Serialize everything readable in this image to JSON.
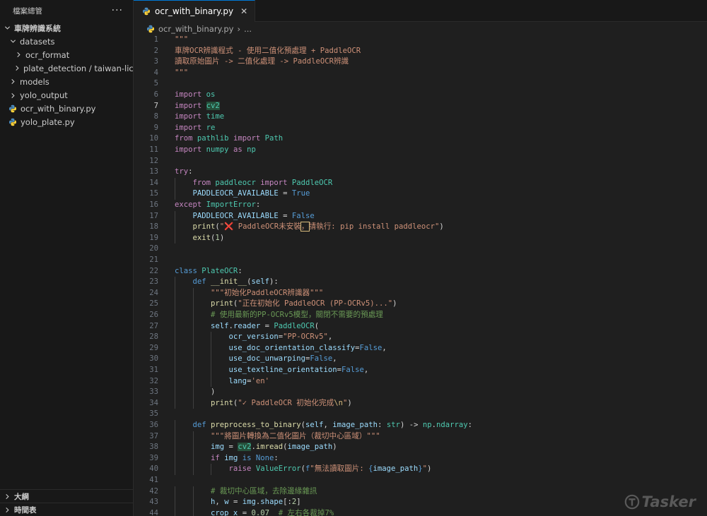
{
  "sidebar": {
    "title": "檔案總管",
    "more": "···",
    "tree": [
      {
        "label": "車牌辨識系統",
        "kind": "folder-root",
        "chevron": "down",
        "indent": 0
      },
      {
        "label": "datasets",
        "kind": "folder",
        "chevron": "down",
        "indent": 1
      },
      {
        "label": "ocr_format",
        "kind": "folder",
        "chevron": "right",
        "indent": 2
      },
      {
        "label": "plate_detection / taiwan-lice...",
        "kind": "folder",
        "chevron": "right",
        "indent": 2
      },
      {
        "label": "models",
        "kind": "folder",
        "chevron": "right",
        "indent": 1
      },
      {
        "label": "yolo_output",
        "kind": "folder",
        "chevron": "right",
        "indent": 1
      },
      {
        "label": "ocr_with_binary.py",
        "kind": "python-file",
        "chevron": "",
        "indent": 1
      },
      {
        "label": "yolo_plate.py",
        "kind": "python-file",
        "chevron": "",
        "indent": 1
      }
    ],
    "footer": [
      {
        "label": "大綱"
      },
      {
        "label": "時間表"
      }
    ]
  },
  "editor": {
    "tab": {
      "label": "ocr_with_binary.py",
      "close": "✕"
    },
    "breadcrumb": {
      "file": "ocr_with_binary.py",
      "rest": "..."
    },
    "current_line": 7,
    "lines": [
      [
        [
          "s",
          "\"\"\""
        ]
      ],
      [
        [
          "s",
          "車牌OCR辨識程式 - 使用二值化預處理 + PaddleOCR"
        ]
      ],
      [
        [
          "s",
          "讀取原始圖片 -> 二值化處理 -> PaddleOCR辨識"
        ]
      ],
      [
        [
          "s",
          "\"\"\""
        ]
      ],
      [],
      [
        [
          "k",
          "import"
        ],
        [
          "p",
          " "
        ],
        [
          "cl",
          "os"
        ]
      ],
      [
        [
          "k",
          "import"
        ],
        [
          "p",
          " "
        ],
        [
          "cl hl",
          "cv2"
        ]
      ],
      [
        [
          "k",
          "import"
        ],
        [
          "p",
          " "
        ],
        [
          "cl",
          "time"
        ]
      ],
      [
        [
          "k",
          "import"
        ],
        [
          "p",
          " "
        ],
        [
          "cl",
          "re"
        ]
      ],
      [
        [
          "k",
          "from"
        ],
        [
          "p",
          " "
        ],
        [
          "cl",
          "pathlib"
        ],
        [
          "p",
          " "
        ],
        [
          "k",
          "import"
        ],
        [
          "p",
          " "
        ],
        [
          "cl",
          "Path"
        ]
      ],
      [
        [
          "k",
          "import"
        ],
        [
          "p",
          " "
        ],
        [
          "cl",
          "numpy"
        ],
        [
          "p",
          " "
        ],
        [
          "k",
          "as"
        ],
        [
          "p",
          " "
        ],
        [
          "cl",
          "np"
        ]
      ],
      [],
      [
        [
          "k",
          "try"
        ],
        [
          "p",
          ":"
        ]
      ],
      [
        [
          "p",
          "    "
        ],
        [
          "k",
          "from"
        ],
        [
          "p",
          " "
        ],
        [
          "cl",
          "paddleocr"
        ],
        [
          "p",
          " "
        ],
        [
          "k",
          "import"
        ],
        [
          "p",
          " "
        ],
        [
          "cl",
          "PaddleOCR"
        ]
      ],
      [
        [
          "p",
          "    "
        ],
        [
          "v",
          "PADDLEOCR_AVAILABLE"
        ],
        [
          "p",
          " = "
        ],
        [
          "kb",
          "True"
        ]
      ],
      [
        [
          "k",
          "except"
        ],
        [
          "p",
          " "
        ],
        [
          "cl",
          "ImportError"
        ],
        [
          "p",
          ":"
        ]
      ],
      [
        [
          "p",
          "    "
        ],
        [
          "v",
          "PADDLEOCR_AVAILABLE"
        ],
        [
          "p",
          " = "
        ],
        [
          "kb",
          "False"
        ]
      ],
      [
        [
          "p",
          "    "
        ],
        [
          "f",
          "print"
        ],
        [
          "p",
          "("
        ],
        [
          "s",
          "\"❌ PaddleOCR未安裝"
        ],
        [
          "s box",
          "，"
        ],
        [
          "s",
          "請執行: pip install paddleocr\""
        ],
        [
          "p",
          ")"
        ]
      ],
      [
        [
          "p",
          "    "
        ],
        [
          "f",
          "exit"
        ],
        [
          "p",
          "("
        ],
        [
          "n",
          "1"
        ],
        [
          "p",
          ")"
        ]
      ],
      [],
      [],
      [
        [
          "kb",
          "class"
        ],
        [
          "p",
          " "
        ],
        [
          "cl",
          "PlateOCR"
        ],
        [
          "p",
          ":"
        ]
      ],
      [
        [
          "p",
          "    "
        ],
        [
          "kb",
          "def"
        ],
        [
          "p",
          " "
        ],
        [
          "f",
          "__init__"
        ],
        [
          "p",
          "("
        ],
        [
          "v",
          "self"
        ],
        [
          "p",
          "):"
        ]
      ],
      [
        [
          "p",
          "        "
        ],
        [
          "s",
          "\"\"\"初始化PaddleOCR辨識器\"\"\""
        ]
      ],
      [
        [
          "p",
          "        "
        ],
        [
          "f",
          "print"
        ],
        [
          "p",
          "("
        ],
        [
          "s",
          "\"正在初始化 PaddleOCR (PP-OCRv5)...\""
        ],
        [
          "p",
          ")"
        ]
      ],
      [
        [
          "p",
          "        "
        ],
        [
          "c",
          "# 使用最新的PP-OCRv5模型，關閉不需要的預處理"
        ]
      ],
      [
        [
          "p",
          "        "
        ],
        [
          "v",
          "self"
        ],
        [
          "p",
          "."
        ],
        [
          "v",
          "reader"
        ],
        [
          "p",
          " = "
        ],
        [
          "cl",
          "PaddleOCR"
        ],
        [
          "p",
          "("
        ]
      ],
      [
        [
          "p",
          "            "
        ],
        [
          "v",
          "ocr_version"
        ],
        [
          "p",
          "="
        ],
        [
          "s",
          "\"PP-OCRv5\""
        ],
        [
          "p",
          ","
        ]
      ],
      [
        [
          "p",
          "            "
        ],
        [
          "v",
          "use_doc_orientation_classify"
        ],
        [
          "p",
          "="
        ],
        [
          "kb",
          "False"
        ],
        [
          "p",
          ","
        ]
      ],
      [
        [
          "p",
          "            "
        ],
        [
          "v",
          "use_doc_unwarping"
        ],
        [
          "p",
          "="
        ],
        [
          "kb",
          "False"
        ],
        [
          "p",
          ","
        ]
      ],
      [
        [
          "p",
          "            "
        ],
        [
          "v",
          "use_textline_orientation"
        ],
        [
          "p",
          "="
        ],
        [
          "kb",
          "False"
        ],
        [
          "p",
          ","
        ]
      ],
      [
        [
          "p",
          "            "
        ],
        [
          "v",
          "lang"
        ],
        [
          "p",
          "="
        ],
        [
          "s",
          "'en'"
        ]
      ],
      [
        [
          "p",
          "        )"
        ]
      ],
      [
        [
          "p",
          "        "
        ],
        [
          "f",
          "print"
        ],
        [
          "p",
          "("
        ],
        [
          "s",
          "\"✓ PaddleOCR 初始化完成"
        ],
        [
          "esc",
          "\\n"
        ],
        [
          "s",
          "\""
        ],
        [
          "p",
          ")"
        ]
      ],
      [],
      [
        [
          "p",
          "    "
        ],
        [
          "kb",
          "def"
        ],
        [
          "p",
          " "
        ],
        [
          "f",
          "preprocess_to_binary"
        ],
        [
          "p",
          "("
        ],
        [
          "v",
          "self"
        ],
        [
          "p",
          ", "
        ],
        [
          "v",
          "image_path"
        ],
        [
          "p",
          ": "
        ],
        [
          "cl",
          "str"
        ],
        [
          "p",
          ") -> "
        ],
        [
          "cl",
          "np"
        ],
        [
          "p",
          "."
        ],
        [
          "cl",
          "ndarray"
        ],
        [
          "p",
          ":"
        ]
      ],
      [
        [
          "p",
          "        "
        ],
        [
          "s",
          "\"\"\"將圖片轉換為二值化圖片（裁切中心區域）\"\"\""
        ]
      ],
      [
        [
          "p",
          "        "
        ],
        [
          "v",
          "img"
        ],
        [
          "p",
          " = "
        ],
        [
          "cl hl",
          "cv2"
        ],
        [
          "p",
          "."
        ],
        [
          "f",
          "imread"
        ],
        [
          "p",
          "("
        ],
        [
          "v",
          "image_path"
        ],
        [
          "p",
          ")"
        ]
      ],
      [
        [
          "p",
          "        "
        ],
        [
          "k",
          "if"
        ],
        [
          "p",
          " "
        ],
        [
          "v",
          "img"
        ],
        [
          "p",
          " "
        ],
        [
          "kb",
          "is"
        ],
        [
          "p",
          " "
        ],
        [
          "kb",
          "None"
        ],
        [
          "p",
          ":"
        ]
      ],
      [
        [
          "p",
          "            "
        ],
        [
          "k",
          "raise"
        ],
        [
          "p",
          " "
        ],
        [
          "cl",
          "ValueError"
        ],
        [
          "p",
          "("
        ],
        [
          "kb",
          "f"
        ],
        [
          "s",
          "\"無法讀取圖片: "
        ],
        [
          "kb",
          "{"
        ],
        [
          "v",
          "image_path"
        ],
        [
          "kb",
          "}"
        ],
        [
          "s",
          "\""
        ],
        [
          "p",
          ")"
        ]
      ],
      [],
      [
        [
          "p",
          "        "
        ],
        [
          "c",
          "# 裁切中心區域，去除邊緣雜訊"
        ]
      ],
      [
        [
          "p",
          "        "
        ],
        [
          "v",
          "h"
        ],
        [
          "p",
          ", "
        ],
        [
          "v",
          "w"
        ],
        [
          "p",
          " = "
        ],
        [
          "v",
          "img"
        ],
        [
          "p",
          "."
        ],
        [
          "v",
          "shape"
        ],
        [
          "p",
          "[:"
        ],
        [
          "n",
          "2"
        ],
        [
          "p",
          "]"
        ]
      ],
      [
        [
          "p",
          "        "
        ],
        [
          "v",
          "crop_x"
        ],
        [
          "p",
          " = "
        ],
        [
          "n",
          "0.07"
        ],
        [
          "p",
          "  "
        ],
        [
          "c",
          "# 左右各裁掉7%"
        ]
      ]
    ]
  },
  "watermark": "Tasker"
}
